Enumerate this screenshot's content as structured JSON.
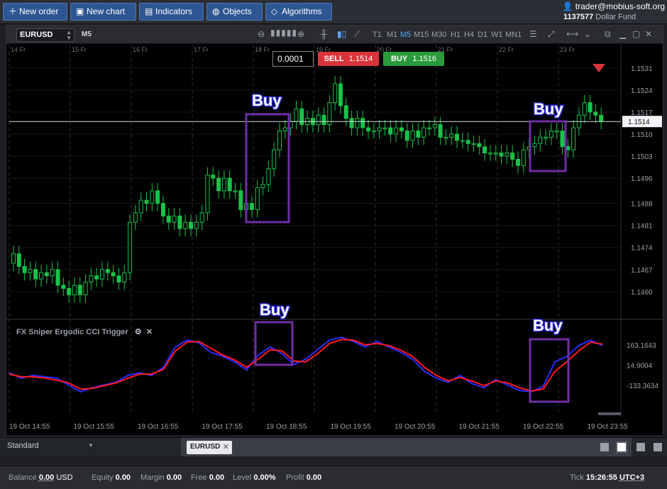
{
  "toolbar": {
    "new_order": "New order",
    "new_chart": "New chart",
    "indicators": "Indicators",
    "objects": "Objects",
    "algorithms": "Algorithms"
  },
  "account": {
    "email": "trader@mobius-soft.org",
    "number": "1137577",
    "fund": "Dollar Fund"
  },
  "chart": {
    "symbol": "EURUSD",
    "timeframe_label": "M5",
    "timeframes": [
      "T1",
      "M1",
      "M5",
      "M15",
      "M30",
      "H1",
      "H4",
      "D1",
      "W1",
      "MN1"
    ],
    "active_timeframe": "M5",
    "lot": "0.0001",
    "sell_label": "SELL",
    "sell_price": "1.1514",
    "buy_label": "BUY",
    "buy_price": "1.1516",
    "current_price": "1.1514",
    "colors": {
      "up": "#19c24a",
      "down": "#19c24a",
      "sell": "#d9343b",
      "buy": "#2a9b3c",
      "annotation": "#6f2fa3",
      "cci_fast": "#2b2bff",
      "cci_slow": "#ff1a1a"
    }
  },
  "chart_data": [
    {
      "type": "candlestick",
      "title": "",
      "price_ticks": [
        "1.1531",
        "1.1524",
        "1.1517",
        "1.1510",
        "1.1503",
        "1.1496",
        "1.1488",
        "1.1481",
        "1.1474",
        "1.1467",
        "1.1460"
      ],
      "ylim": [
        1.1455,
        1.1535
      ],
      "top_date_labels": [
        "14 Fr",
        "15 Fr",
        "16 Fr",
        "17 Fr",
        "18 Fr",
        "19 Fr",
        "20 Fr",
        "21 Fr",
        "22 Fr",
        "23 Fr"
      ],
      "time_labels": [
        "19 Oct 14:55",
        "19 Oct 15:55",
        "19 Oct 16:55",
        "19 Oct 17:55",
        "19 Oct 18:55",
        "19 Oct 19:55",
        "19 Oct 20:55",
        "19 Oct 21:55",
        "19 Oct 22:55",
        "19 Oct 23:55"
      ],
      "current_price": 1.1514,
      "closes": [
        1.1472,
        1.1468,
        1.1466,
        1.1467,
        1.1464,
        1.1466,
        1.1465,
        1.1467,
        1.1462,
        1.1461,
        1.1459,
        1.1462,
        1.1459,
        1.1463,
        1.1465,
        1.1464,
        1.1467,
        1.1466,
        1.1465,
        1.1463,
        1.1466,
        1.1482,
        1.1485,
        1.1489,
        1.1488,
        1.1492,
        1.1488,
        1.1484,
        1.1482,
        1.1484,
        1.148,
        1.1482,
        1.148,
        1.1482,
        1.1485,
        1.1497,
        1.1496,
        1.1492,
        1.1496,
        1.1492,
        1.1492,
        1.1486,
        1.1488,
        1.1486,
        1.1493,
        1.1494,
        1.1499,
        1.1505,
        1.1511,
        1.1512,
        1.1514,
        1.1518,
        1.1513,
        1.1515,
        1.1513,
        1.1516,
        1.1513,
        1.152,
        1.1526,
        1.1519,
        1.1515,
        1.1512,
        1.1515,
        1.1512,
        1.1511,
        1.1511,
        1.1512,
        1.1512,
        1.151,
        1.1512,
        1.1511,
        1.1508,
        1.1511,
        1.1509,
        1.1512,
        1.1512,
        1.1513,
        1.1509,
        1.1509,
        1.151,
        1.1508,
        1.1508,
        1.1507,
        1.1507,
        1.1506,
        1.1504,
        1.1504,
        1.1504,
        1.1503,
        1.1504,
        1.1502,
        1.15,
        1.1505,
        1.1506,
        1.1507,
        1.1509,
        1.1509,
        1.1511,
        1.1511,
        1.1506,
        1.1505,
        1.1512,
        1.1516,
        1.152,
        1.1517,
        1.1516,
        1.1514
      ],
      "annotations": [
        "Buy",
        "Buy"
      ]
    },
    {
      "type": "line",
      "title": "FX Sniper Ergodic CCI Trigger",
      "value_ticks": [
        "163.1643",
        "14.9004",
        "-133.3634"
      ],
      "ylim": [
        -300,
        300
      ],
      "series": [
        {
          "values": [
            -40,
            -80,
            -60,
            -70,
            -80,
            -130,
            -180,
            -150,
            -130,
            -110,
            -60,
            -40,
            -60,
            0,
            150,
            200,
            180,
            110,
            80,
            40,
            -20,
            90,
            150,
            100,
            20,
            60,
            130,
            200,
            220,
            190,
            150,
            190,
            150,
            110,
            60,
            -30,
            -80,
            -110,
            -60,
            -120,
            -150,
            -90,
            -130,
            -170,
            -180,
            -140,
            40,
            80,
            160,
            200,
            160
          ]
        },
        {
          "values": [
            -50,
            -70,
            -70,
            -80,
            -95,
            -115,
            -160,
            -155,
            -135,
            -115,
            -80,
            -50,
            -50,
            -15,
            120,
            185,
            190,
            140,
            90,
            55,
            0,
            60,
            130,
            120,
            45,
            40,
            100,
            175,
            205,
            200,
            165,
            175,
            160,
            125,
            80,
            0,
            -60,
            -100,
            -75,
            -100,
            -135,
            -100,
            -115,
            -150,
            -175,
            -160,
            -30,
            40,
            120,
            185,
            170
          ]
        }
      ],
      "annotations": [
        "Buy",
        "Buy"
      ]
    }
  ],
  "tabs": {
    "workspace": "Standard",
    "chart_tab": "EURUSD"
  },
  "status": {
    "balance_label": "Balance",
    "balance_value": "0.00",
    "balance_currency": "USD",
    "equity_label": "Equity",
    "equity_value": "0.00",
    "margin_label": "Margin",
    "margin_value": "0.00",
    "free_label": "Free",
    "free_value": "0.00",
    "level_label": "Level",
    "level_value": "0.00%",
    "profit_label": "Profit",
    "profit_value": "0.00",
    "tick_label": "Tick",
    "tick_time": "15:26:55",
    "timezone": "UTC+3"
  }
}
